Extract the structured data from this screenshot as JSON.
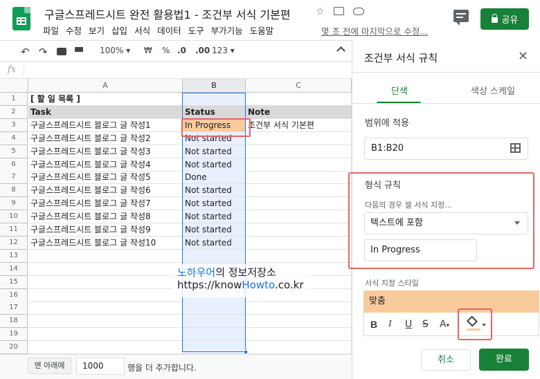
{
  "header": {
    "doc_title": "구글스프레드시트 완전 활용법1 - 조건부 서식 기본편",
    "menu": [
      "파일",
      "수정",
      "보기",
      "삽입",
      "서식",
      "데이터",
      "도구",
      "부가기능",
      "도움말"
    ],
    "last_edit": "몇 초 전에 마지막으로 수정...",
    "share_label": "공유",
    "brand_color": "#0f9d58",
    "share_color": "#188038"
  },
  "toolbar": {
    "zoom": "100%",
    "currency": "₩",
    "percent": "%",
    "decimal_less": ".0",
    "decimal_more": ".00",
    "more_formats": "123"
  },
  "formula_bar": {
    "fx": "fx"
  },
  "sheet": {
    "columns": [
      "A",
      "B",
      "C"
    ],
    "selected_column": "B",
    "rows": [
      {
        "n": "1",
        "a": "[ 할 일 목록 ]",
        "b": "",
        "c": ""
      },
      {
        "n": "2",
        "a": "Task",
        "b": "Status",
        "c": "Note"
      },
      {
        "n": "3",
        "a": "구글스프레드시트 블로그 글 작성1",
        "b": "In Progress",
        "c": "조건부 서식 기본편"
      },
      {
        "n": "4",
        "a": "구글스프레드시트 블로그 글 작성2",
        "b": "Not started",
        "c": ""
      },
      {
        "n": "5",
        "a": "구글스프레드시트 블로그 글 작성3",
        "b": "Not started",
        "c": ""
      },
      {
        "n": "6",
        "a": "구글스프레드시트 블로그 글 작성4",
        "b": "Not started",
        "c": ""
      },
      {
        "n": "7",
        "a": "구글스프레드시트 블로그 글 작성5",
        "b": "Done",
        "c": ""
      },
      {
        "n": "8",
        "a": "구글스프레드시트 블로그 글 작성6",
        "b": "Not started",
        "c": ""
      },
      {
        "n": "9",
        "a": "구글스프레드시트 블로그 글 작성7",
        "b": "Not started",
        "c": ""
      },
      {
        "n": "10",
        "a": "구글스프레드시트 블로그 글 작성8",
        "b": "Not started",
        "c": ""
      },
      {
        "n": "11",
        "a": "구글스프레드시트 블로그 글 작성9",
        "b": "Not started",
        "c": ""
      },
      {
        "n": "12",
        "a": "구글스프레드시트 블로그 글 작성10",
        "b": "Not started",
        "c": ""
      },
      {
        "n": "13",
        "a": "",
        "b": "",
        "c": ""
      },
      {
        "n": "14",
        "a": "",
        "b": "",
        "c": ""
      },
      {
        "n": "15",
        "a": "",
        "b": "",
        "c": ""
      },
      {
        "n": "16",
        "a": "",
        "b": "",
        "c": ""
      },
      {
        "n": "17",
        "a": "",
        "b": "",
        "c": ""
      },
      {
        "n": "18",
        "a": "",
        "b": "",
        "c": ""
      },
      {
        "n": "19",
        "a": "",
        "b": "",
        "c": ""
      },
      {
        "n": "20",
        "a": "",
        "b": "",
        "c": ""
      }
    ],
    "highlight_color": "#f9cb9c",
    "header_row_color": "#d9d9d9"
  },
  "watermark": {
    "line1_blue": "노하우어",
    "line1_rest": "의 정보저장소",
    "line2_pre": "https://know",
    "line2_blue": "Howto",
    "line2_post": ".co.kr"
  },
  "bottom": {
    "add_button": "맨 아래에",
    "rows_value": "1000",
    "add_text": "행을 더 추가합니다."
  },
  "panel": {
    "title": "조건부 서식 규칙",
    "tab_single": "단색",
    "tab_scale": "색상 스케일",
    "range_label": "범위에 적용",
    "range_value": "B1:B20",
    "format_rules_label": "형식 규칙",
    "condition_label": "다음의 경우 셀 서식 지정...",
    "condition_value": "텍스트에 포함",
    "value": "In Progress",
    "style_label": "서식 지정 스타일",
    "preview_text": "맞춤",
    "cancel": "취소",
    "done": "완료",
    "fill_color": "#f9cb9c"
  }
}
